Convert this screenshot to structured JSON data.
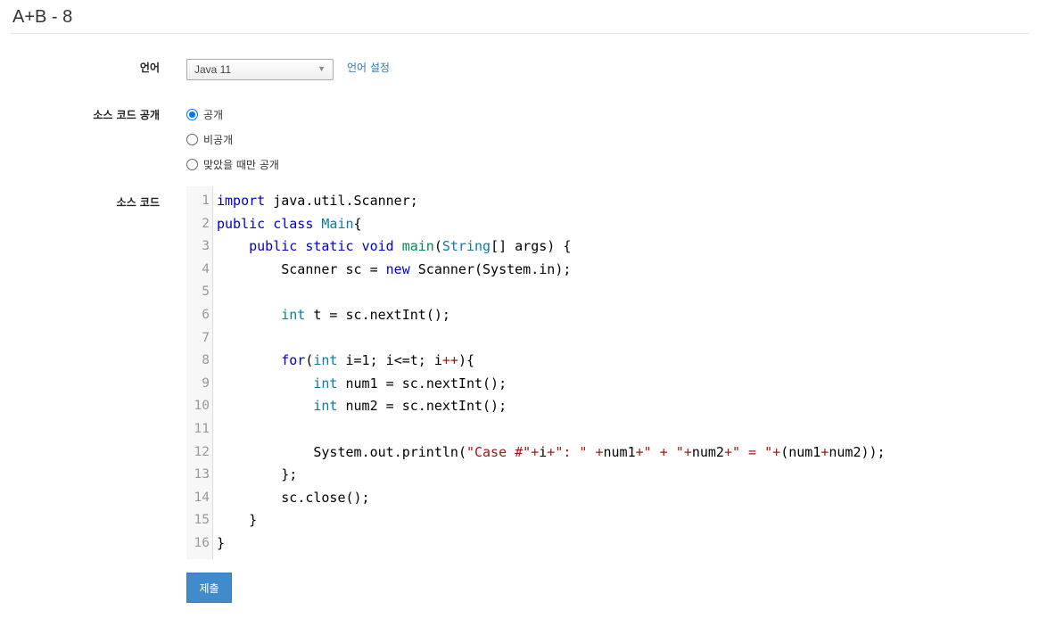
{
  "page": {
    "title": "A+B - 8"
  },
  "form": {
    "language_label": "언어",
    "language_selected": "Java 11",
    "language_settings_link": "언어 설정",
    "visibility_label": "소스 코드 공개",
    "visibility_options": [
      {
        "label": "공개",
        "checked": true
      },
      {
        "label": "비공개",
        "checked": false
      },
      {
        "label": "맞았을 때만 공개",
        "checked": false
      }
    ],
    "source_label": "소스 코드",
    "submit_label": "제출"
  },
  "code": {
    "lines": [
      "import java.util.Scanner;",
      "public class Main{",
      "    public static void main(String[] args) {",
      "        Scanner sc = new Scanner(System.in);",
      "",
      "        int t = sc.nextInt();",
      "",
      "        for(int i=1; i<=t; i++){",
      "            int num1 = sc.nextInt();",
      "            int num2 = sc.nextInt();",
      "",
      "            System.out.println(\"Case #\"+i+\": \" +num1+\" + \"+num2+\" = \"+(num1+num2));",
      "        };",
      "        sc.close();",
      "    }",
      "}"
    ]
  },
  "colors": {
    "link": "#3277b3",
    "button": "#428bca",
    "keyword": "#0000cc",
    "type": "#0a7ca3",
    "string": "#aa1111"
  }
}
